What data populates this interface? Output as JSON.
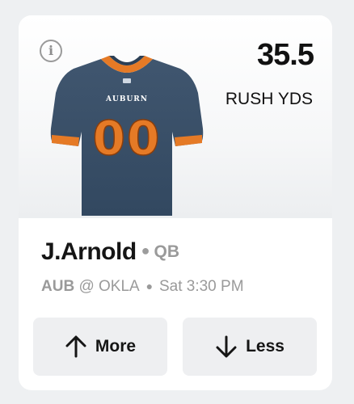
{
  "prop": {
    "stat_value": "35.5",
    "stat_label": "RUSH YDS",
    "info_icon": "info-icon",
    "jersey": {
      "team_text": "AUBURN",
      "number": "00",
      "body_color": "#3a5068",
      "accent_color": "#e57a26"
    }
  },
  "player": {
    "name": "J.Arnold",
    "position": "QB"
  },
  "game": {
    "team": "AUB",
    "matchup": "@ OKLA",
    "time": "Sat 3:30 PM"
  },
  "actions": {
    "more_label": "More",
    "more_icon": "arrow-up-icon",
    "less_label": "Less",
    "less_icon": "arrow-down-icon"
  }
}
